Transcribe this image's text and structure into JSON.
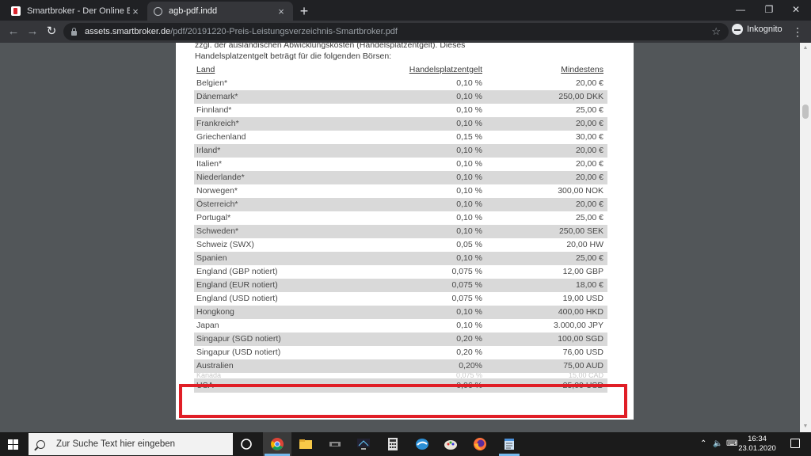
{
  "tabs": [
    {
      "title": "Smartbroker - Der Online Broker",
      "close": "×"
    },
    {
      "title": "agb-pdf.indd",
      "close": "×"
    }
  ],
  "new_tab": "+",
  "window_controls": {
    "minimize": "—",
    "maximize": "❐",
    "close": "✕"
  },
  "toolbar": {
    "back": "←",
    "forward": "→",
    "reload": "↻",
    "url_host": "assets.smartbroker.de",
    "url_path": "/pdf/20191220-Preis-Leistungsverzeichnis-Smartbroker.pdf",
    "star": "☆",
    "incognito_label": "Inkognito",
    "menu": "⋮"
  },
  "pdf": {
    "intro_line1": "zzgl. der ausländischen Abwicklungskosten (Handelsplatzentgelt). Dieses",
    "intro_line2": "Handelsplatzentgelt beträgt für die folgenden Börsen:",
    "headers": {
      "land": "Land",
      "entgelt": "Handelsplatzentgelt",
      "mindestens": "Mindestens"
    },
    "rows": [
      {
        "land": "Belgien*",
        "entgelt": "0,10 %",
        "min": "20,00 €"
      },
      {
        "land": "Dänemark*",
        "entgelt": "0,10 %",
        "min": "250,00 DKK"
      },
      {
        "land": "Finnland*",
        "entgelt": "0,10 %",
        "min": "25,00 €"
      },
      {
        "land": "Frankreich*",
        "entgelt": "0,10 %",
        "min": "20,00 €"
      },
      {
        "land": "Griechenland",
        "entgelt": "0,15 %",
        "min": "30,00 €"
      },
      {
        "land": "Irland*",
        "entgelt": "0,10 %",
        "min": "20,00 €"
      },
      {
        "land": "Italien*",
        "entgelt": "0,10 %",
        "min": "20,00 €"
      },
      {
        "land": "Niederlande*",
        "entgelt": "0,10 %",
        "min": "20,00 €"
      },
      {
        "land": "Norwegen*",
        "entgelt": "0,10 %",
        "min": "300,00 NOK"
      },
      {
        "land": "Österreich*",
        "entgelt": "0,10 %",
        "min": "20,00 €"
      },
      {
        "land": "Portugal*",
        "entgelt": "0,10 %",
        "min": "25,00 €"
      },
      {
        "land": "Schweden*",
        "entgelt": "0,10 %",
        "min": "250,00 SEK"
      },
      {
        "land": "Schweiz (SWX)",
        "entgelt": "0,05 %",
        "min": "20,00 HW"
      },
      {
        "land": "Spanien",
        "entgelt": "0,10 %",
        "min": "25,00 €"
      },
      {
        "land": "England (GBP notiert)",
        "entgelt": "0,075 %",
        "min": "12,00 GBP"
      },
      {
        "land": "England (EUR notiert)",
        "entgelt": "0,075 %",
        "min": "18,00 €"
      },
      {
        "land": "England (USD notiert)",
        "entgelt": "0,075 %",
        "min": "19,00 USD"
      },
      {
        "land": "Hongkong",
        "entgelt": "0,10 %",
        "min": "400,00 HKD"
      },
      {
        "land": "Japan",
        "entgelt": "0,10 %",
        "min": "3.000,00 JPY"
      },
      {
        "land": "Singapur (SGD notiert)",
        "entgelt": "0,20 %",
        "min": "100,00 SGD"
      },
      {
        "land": "Singapur (USD notiert)",
        "entgelt": "0,20 %",
        "min": "76,00 USD"
      },
      {
        "land": "Australien",
        "entgelt": "0,20%",
        "min": "75,00 AUD"
      }
    ],
    "ghost_row": {
      "land": "Kanada",
      "entgelt": "0,075 %",
      "min": "15,00 CAD"
    },
    "last_row": {
      "land": "USA",
      "entgelt": "0,06 %",
      "min": "25,00 USD"
    }
  },
  "taskbar": {
    "search_placeholder": "Zur Suche Text hier eingeben",
    "tray_chevron": "⌃",
    "tray_volume": "🔈",
    "tray_lang": "⌨",
    "time": "16:34",
    "date": "23.01.2020"
  },
  "colors": {
    "highlight": "#e01e26",
    "row_shade": "#d9d9d9",
    "chrome_dark": "#202124"
  }
}
